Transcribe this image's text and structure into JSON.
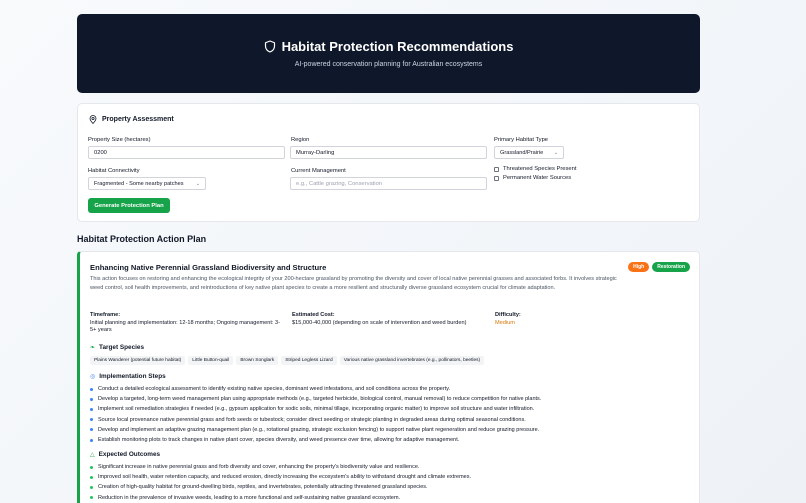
{
  "header": {
    "title": "Habitat Protection Recommendations",
    "subtitle": "AI-powered conservation planning for Australian ecosystems",
    "icon": "shield-icon"
  },
  "assessment": {
    "heading": "Property Assessment",
    "property_size": {
      "label": "Property Size (hectares)",
      "value": "0200"
    },
    "region": {
      "label": "Region",
      "value": "Murray-Darling"
    },
    "habitat_type": {
      "label": "Primary Habitat Type",
      "value": "Grassland/Prairie"
    },
    "connectivity": {
      "label": "Habitat Connectivity",
      "value": "Fragmented - Some nearby patches"
    },
    "management": {
      "label": "Current Management",
      "placeholder": "e.g., Cattle grazing, Conservation"
    },
    "threatened": {
      "label": "Threatened Species Present",
      "checked": false
    },
    "water": {
      "label": "Permanent Water Sources",
      "checked": false
    },
    "generate_label": "Generate Protection Plan"
  },
  "plan_section_title": "Habitat Protection Action Plan",
  "plan": {
    "title": "Enhancing Native Perennial Grassland Biodiversity and Structure",
    "badges": {
      "priority": "High",
      "category": "Restoration"
    },
    "description": "This action focuses on restoring and enhancing the ecological integrity of your 200-hectare grassland by promoting the diversity and cover of local native perennial grasses and associated forbs. It involves strategic weed control, soil health improvements, and reintroductions of key native plant species to create a more resilient and structurally diverse grassland ecosystem crucial for climate adaptation.",
    "timeframe": {
      "label": "Timeframe:",
      "value": "Initial planning and implementation: 12-18 months; Ongoing management: 3-5+ years"
    },
    "cost": {
      "label": "Estimated Cost:",
      "value": "$15,000-40,000 (depending on scale of intervention and weed burden)"
    },
    "difficulty": {
      "label": "Difficulty:",
      "value": "Medium"
    },
    "target_heading": "Target Species",
    "species": [
      "Plains Wanderer (potential future habitat)",
      "Little Button-quail",
      "Brown Songlark",
      "Striped Legless Lizard",
      "Various native grassland invertebrates (e.g., pollinators, beetles)"
    ],
    "steps_heading": "Implementation Steps",
    "steps": [
      "Conduct a detailed ecological assessment to identify existing native species, dominant weed infestations, and soil conditions across the property.",
      "Develop a targeted, long-term weed management plan using appropriate methods (e.g., targeted herbicide, biological control, manual removal) to reduce competition for native plants.",
      "Implement soil remediation strategies if needed (e.g., gypsum application for sodic soils, minimal tillage, incorporating organic matter) to improve soil structure and water infiltration.",
      "Source local provenance native perennial grass and forb seeds or tubestock; consider direct seeding or strategic planting in degraded areas during optimal seasonal conditions.",
      "Develop and implement an adaptive grazing management plan (e.g., rotational grazing, strategic exclusion fencing) to support native plant regeneration and reduce grazing pressure.",
      "Establish monitoring plots to track changes in native plant cover, species diversity, and weed presence over time, allowing for adaptive management."
    ],
    "outcomes_heading": "Expected Outcomes",
    "outcomes": [
      "Significant increase in native perennial grass and forb diversity and cover, enhancing the property's biodiversity value and resilience.",
      "Improved soil health, water retention capacity, and reduced erosion, directly increasing the ecosystem's ability to withstand drought and climate extremes.",
      "Creation of high-quality habitat for ground-dwelling birds, reptiles, and invertebrates, potentially attracting threatened grassland species.",
      "Reduction in the prevalence of invasive weeds, leading to a more functional and self-sustaining native grassland ecosystem."
    ]
  },
  "colors": {
    "header_bg": "#0f172a",
    "accent_green": "#16a34a",
    "high_badge": "#f97316",
    "difficulty_medium": "#d97706"
  }
}
